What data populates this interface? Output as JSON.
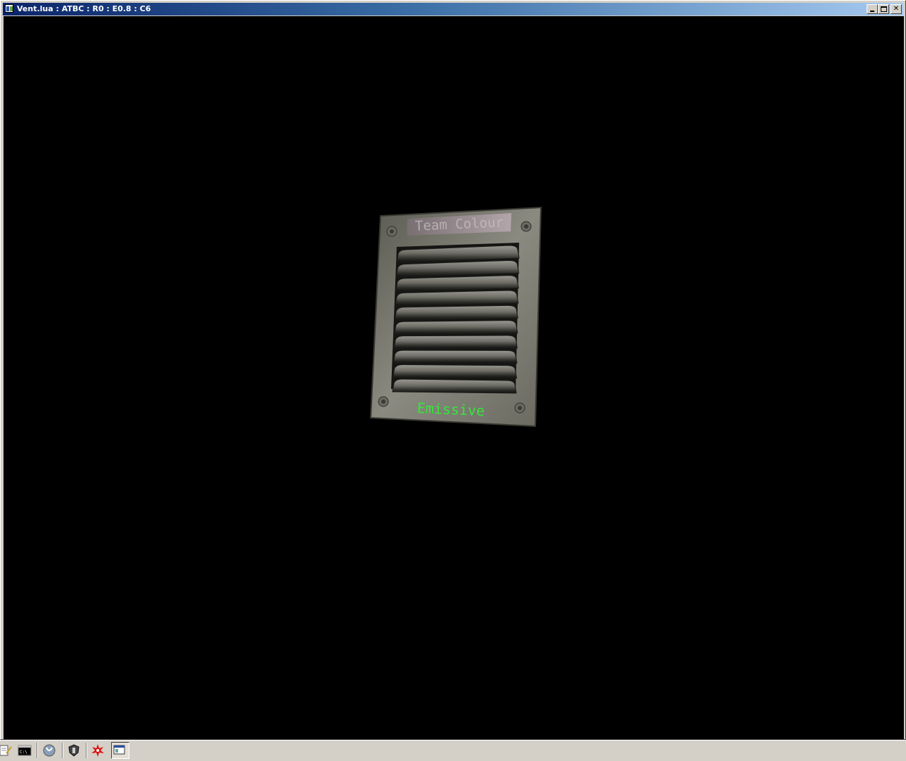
{
  "window": {
    "title": "Vent.lua : ATBC : R0 : E0.8 : C6",
    "controls": {
      "minimize": "minimize",
      "maximize": "maximize",
      "close": "✕"
    }
  },
  "viewport": {
    "background": "#000000",
    "model": {
      "name": "vent",
      "top_label": "Team Colour",
      "bottom_label": "Emissive",
      "top_label_color": "#c8bfc2",
      "bottom_label_color": "#35e63a",
      "louver_count": 10
    }
  },
  "taskbar": {
    "icons": [
      "notepad-icon",
      "cmd-icon",
      "app-icon",
      "shield-icon",
      "splat-icon",
      "window-icon"
    ]
  }
}
